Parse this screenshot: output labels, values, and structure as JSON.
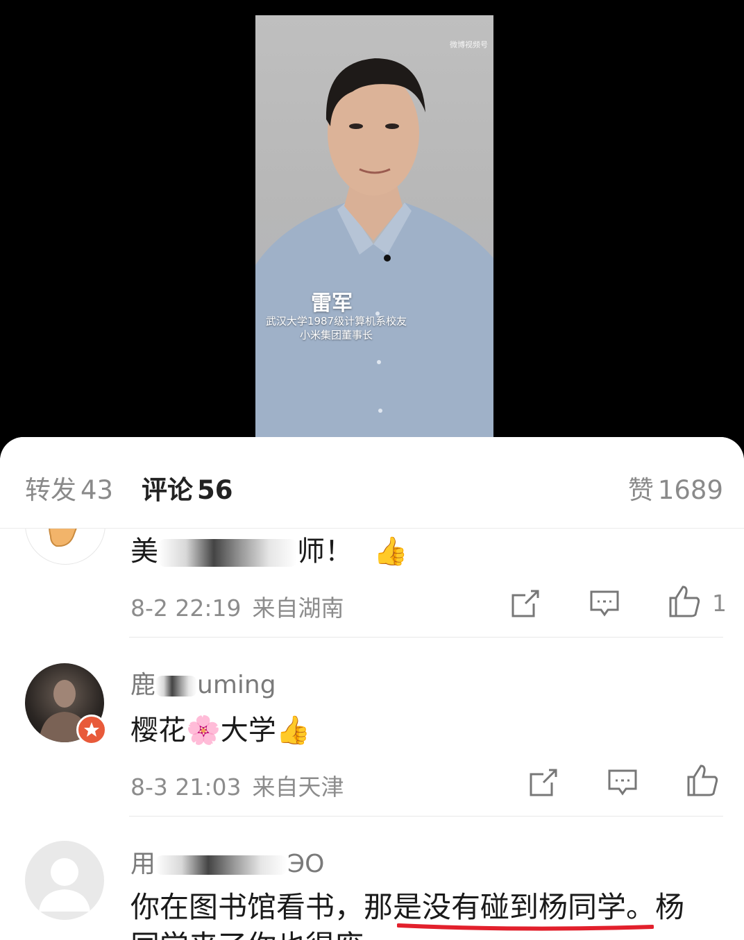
{
  "video": {
    "watermark": "微博视频号",
    "caption_name": "雷军",
    "caption_line1": "武汉大学1987级计算机系校友",
    "caption_line2": "小米集团董事长"
  },
  "tabs": {
    "repost_label": "转发",
    "repost_count": "43",
    "comment_label": "评论",
    "comment_count": "56",
    "like_label": "赞",
    "like_count": "1689"
  },
  "comments": [
    {
      "text_start": "美",
      "text_end": "师！",
      "emoji": "👍",
      "time": "8-2 22:19",
      "location": "来自湖南",
      "likes": "1"
    },
    {
      "name_start": "鹿",
      "name_end": "uming",
      "text": "樱花🌸大学👍",
      "time": "8-3 21:03",
      "location": "来自天津",
      "likes": ""
    },
    {
      "name_start": "用",
      "name_end": "ЭО",
      "text": "你在图书馆看书，那是没有碰到杨同学。杨",
      "text_line2": "同学来了你也得废"
    }
  ],
  "colors": {
    "underline": "#e2202c",
    "badge": "#e85a3a"
  }
}
